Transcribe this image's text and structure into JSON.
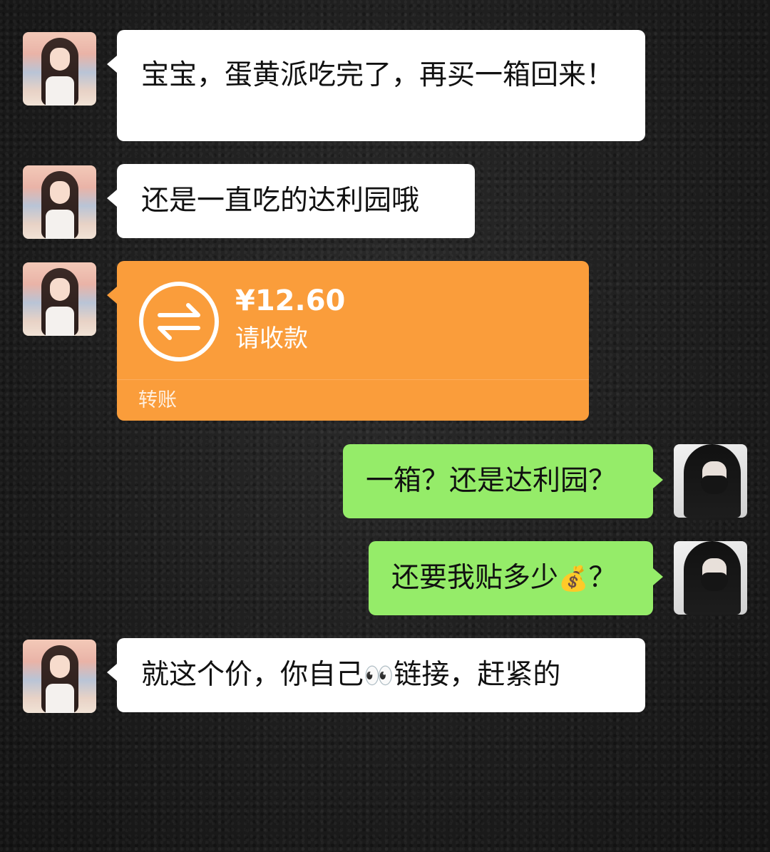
{
  "messages": [
    {
      "side": "left",
      "text": "宝宝，蛋黄派吃完了，再买一箱回来！"
    },
    {
      "side": "left",
      "text": "还是一直吃的达利园哦"
    },
    {
      "side": "left",
      "type": "transfer",
      "amount": "¥12.60",
      "subtitle": "请收款",
      "footer": "转账",
      "icon": "transfer-arrows-icon"
    },
    {
      "side": "right",
      "text": "一箱？还是达利园？"
    },
    {
      "side": "right",
      "text_before": "还要我贴多少",
      "emoji": "💰",
      "text_after": "？"
    },
    {
      "side": "left",
      "text_before": "就这个价，你自己",
      "emoji": "👀",
      "text_after": "链接，赶紧的"
    }
  ],
  "colors": {
    "left_bubble": "#ffffff",
    "right_bubble": "#95ec69",
    "transfer_card": "#fa9d3b",
    "background": "#1c1c1c"
  }
}
